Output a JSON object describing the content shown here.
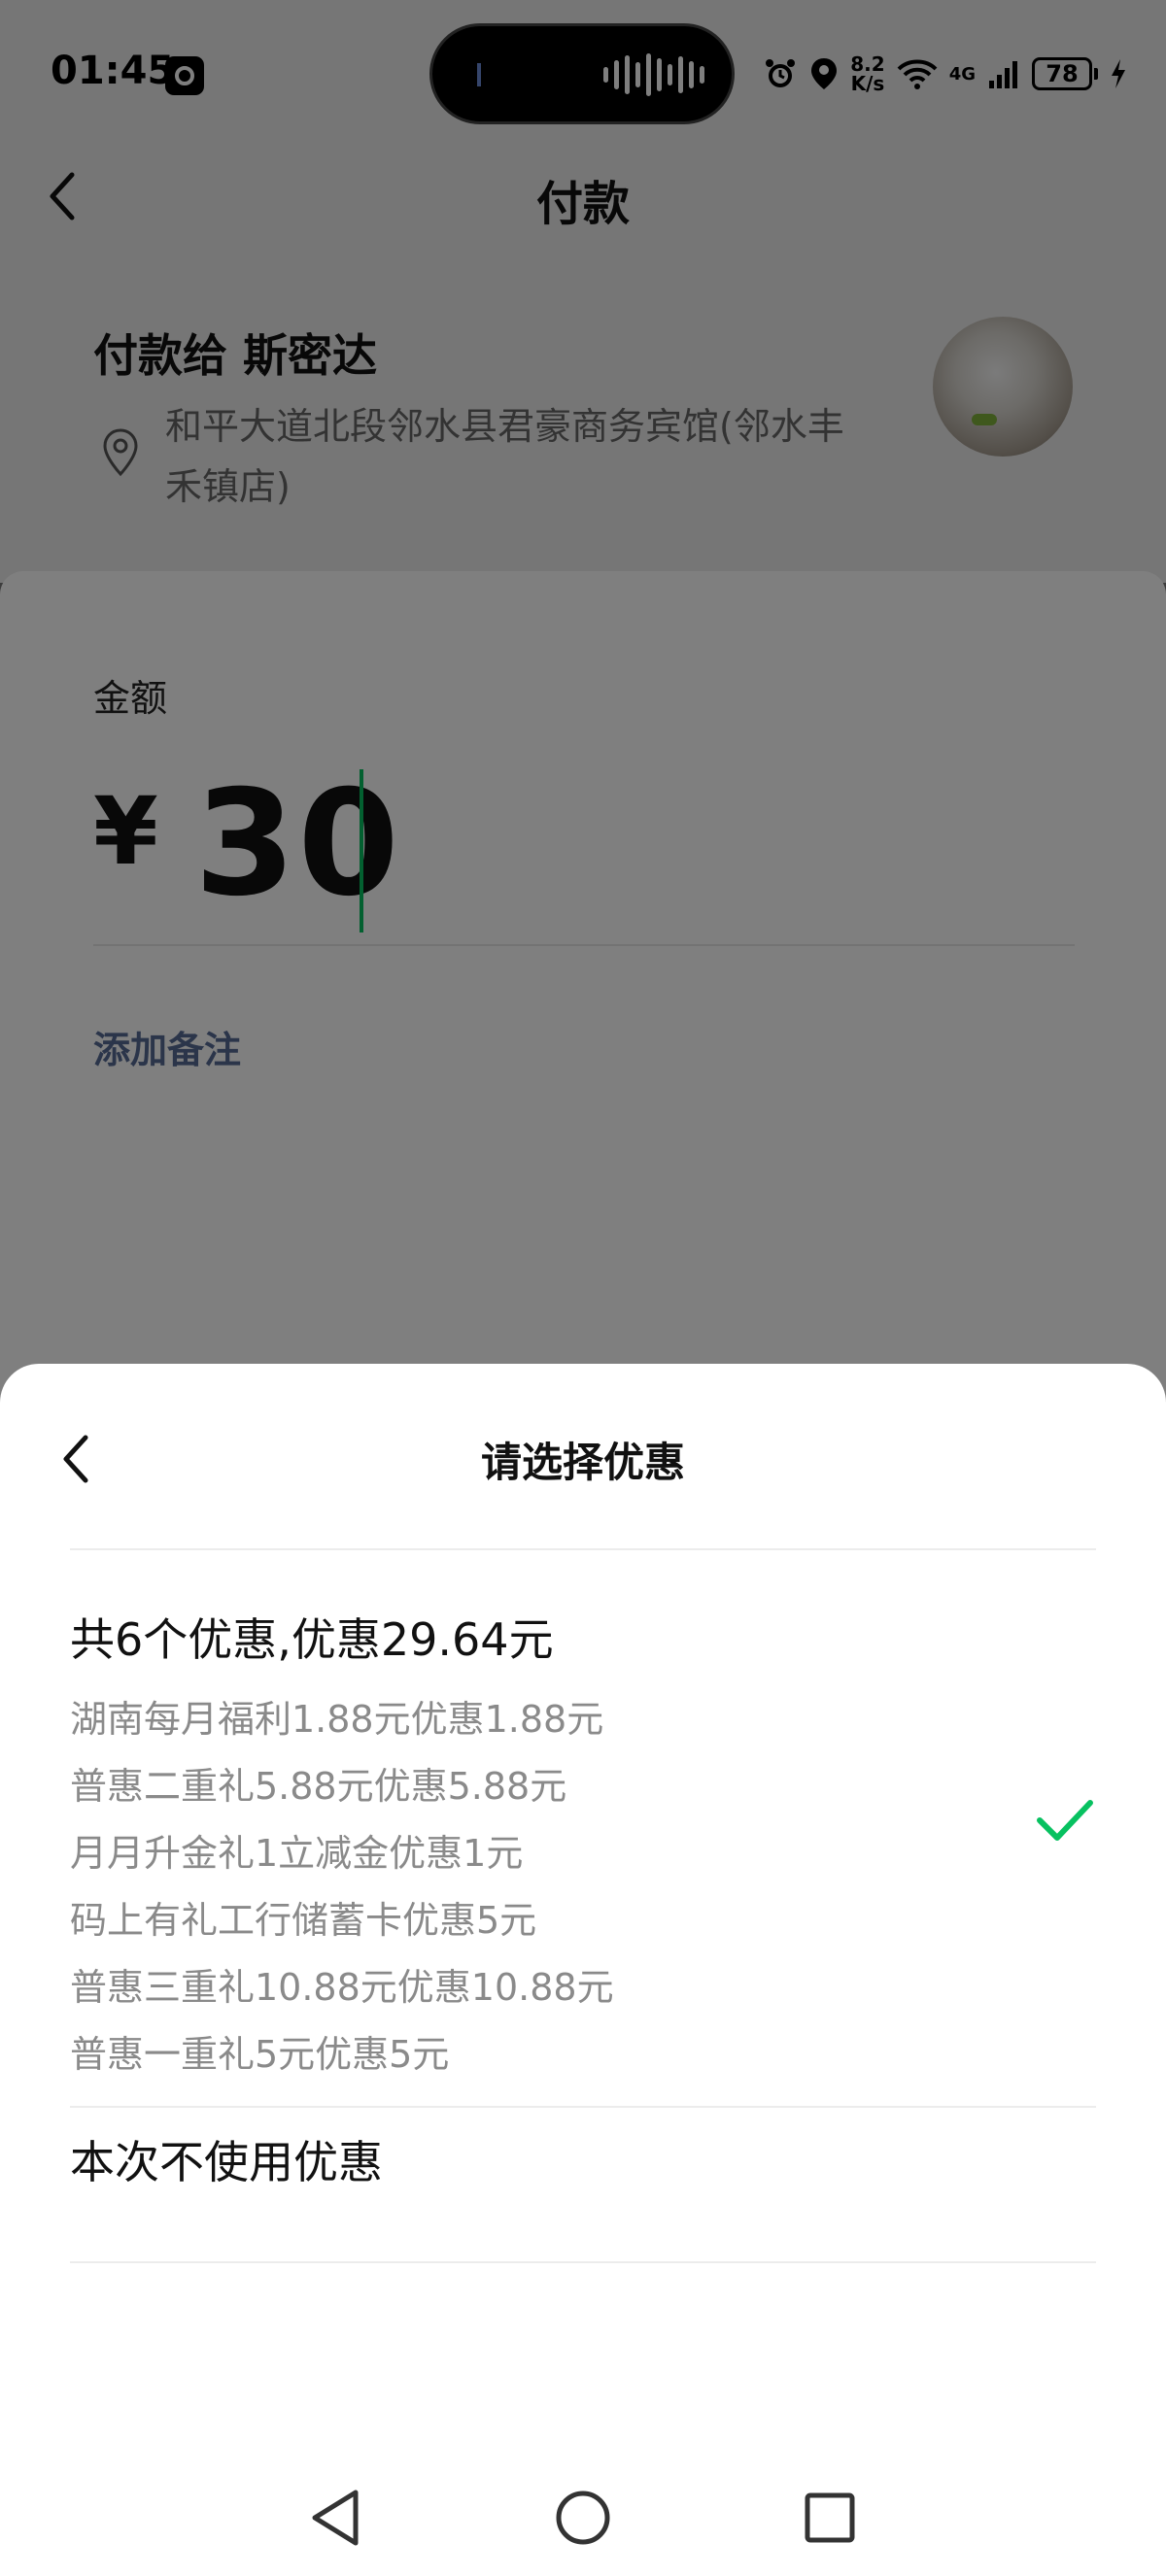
{
  "status_bar": {
    "time": "01:45",
    "net_speed_value": "8.2",
    "net_speed_unit": "K/s",
    "network_type": "4G",
    "battery_level": "78"
  },
  "header": {
    "title": "付款"
  },
  "payee": {
    "label": "付款给 斯密达",
    "address": "和平大道北段邻水县君豪商务宾馆(邻水丰禾镇店)"
  },
  "amount": {
    "label": "金额",
    "currency_symbol": "¥",
    "value": "30"
  },
  "add_note_label": "添加备注",
  "discount_sheet": {
    "title": "请选择优惠",
    "all_option": {
      "summary": "共6个优惠,优惠29.64元",
      "selected": true,
      "items": [
        "湖南每月福利1.88元优惠1.88元",
        "普惠二重礼5.88元优惠5.88元",
        "月月升金礼1立减金优惠1元",
        "码上有礼工行储蓄卡优惠5元",
        "普惠三重礼10.88元优惠10.88元",
        "普惠一重礼5元优惠5元"
      ]
    },
    "none_option": {
      "label": "本次不使用优惠"
    }
  },
  "colors": {
    "accent_green": "#07c160",
    "link_blue": "#576b95",
    "overlay": "rgba(0,0,0,0.5)"
  },
  "icons": {
    "back": "chevron-left-icon",
    "location": "location-pin-icon",
    "check": "checkmark-icon",
    "nav_back": "triangle-back-icon",
    "nav_home": "circle-home-icon",
    "nav_recents": "square-recents-icon"
  }
}
